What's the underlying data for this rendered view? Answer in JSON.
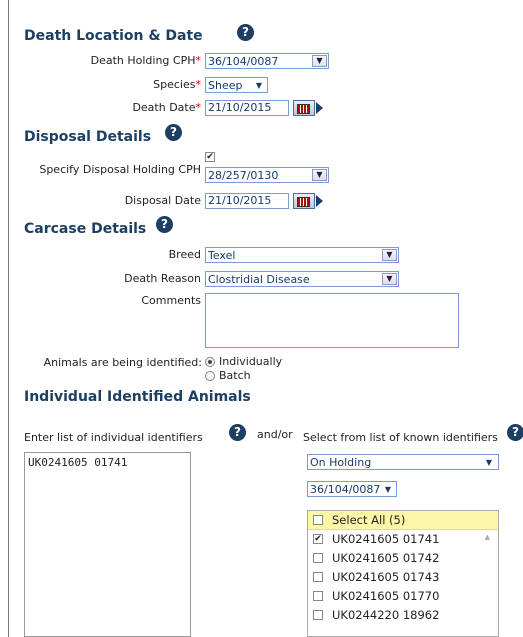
{
  "death": {
    "title": "Death Location & Date",
    "holding_label": "Death Holding CPH",
    "holding_value": "36/104/0087",
    "species_label": "Species",
    "species_value": "Sheep",
    "date_label": "Death Date",
    "date_value": "21/10/2015",
    "required_mark": "*"
  },
  "disposal": {
    "title": "Disposal Details",
    "holding_label": "Specify Disposal Holding CPH",
    "holding_value": "28/257/0130",
    "holding_checked": true,
    "date_label": "Disposal Date",
    "date_value": "21/10/2015"
  },
  "carcase": {
    "title": "Carcase Details",
    "breed_label": "Breed",
    "breed_value": "Texel",
    "reason_label": "Death Reason",
    "reason_value": "Clostridial Disease",
    "comments_label": "Comments",
    "identified_label": "Animals are being identified:",
    "opt_individually": "Individually",
    "opt_batch": "Batch",
    "selected_option": "Individually"
  },
  "individual": {
    "title": "Individual Identified Animals",
    "enter_label": "Enter list of individual identifiers",
    "andor": "and/or",
    "select_label": "Select from list of known identifiers",
    "entered_ids": [
      "UK0241605 01741"
    ],
    "source_value": "On Holding",
    "cph_value": "36/104/0087",
    "select_all": "Select All (5)",
    "known_ids": [
      {
        "id": "UK0241605 01741",
        "checked": true
      },
      {
        "id": "UK0241605 01742",
        "checked": false
      },
      {
        "id": "UK0241605 01743",
        "checked": false
      },
      {
        "id": "UK0241605 01770",
        "checked": false
      },
      {
        "id": "UK0244220 18962",
        "checked": false
      }
    ]
  },
  "icons": {
    "help": "?",
    "dropdown": "▼",
    "checkmark": "✔"
  },
  "colors": {
    "heading": "#1d3f63",
    "required": "#cc0000",
    "field_border": "#7a9cd3",
    "select_all_bg": "#fbf6a8"
  }
}
